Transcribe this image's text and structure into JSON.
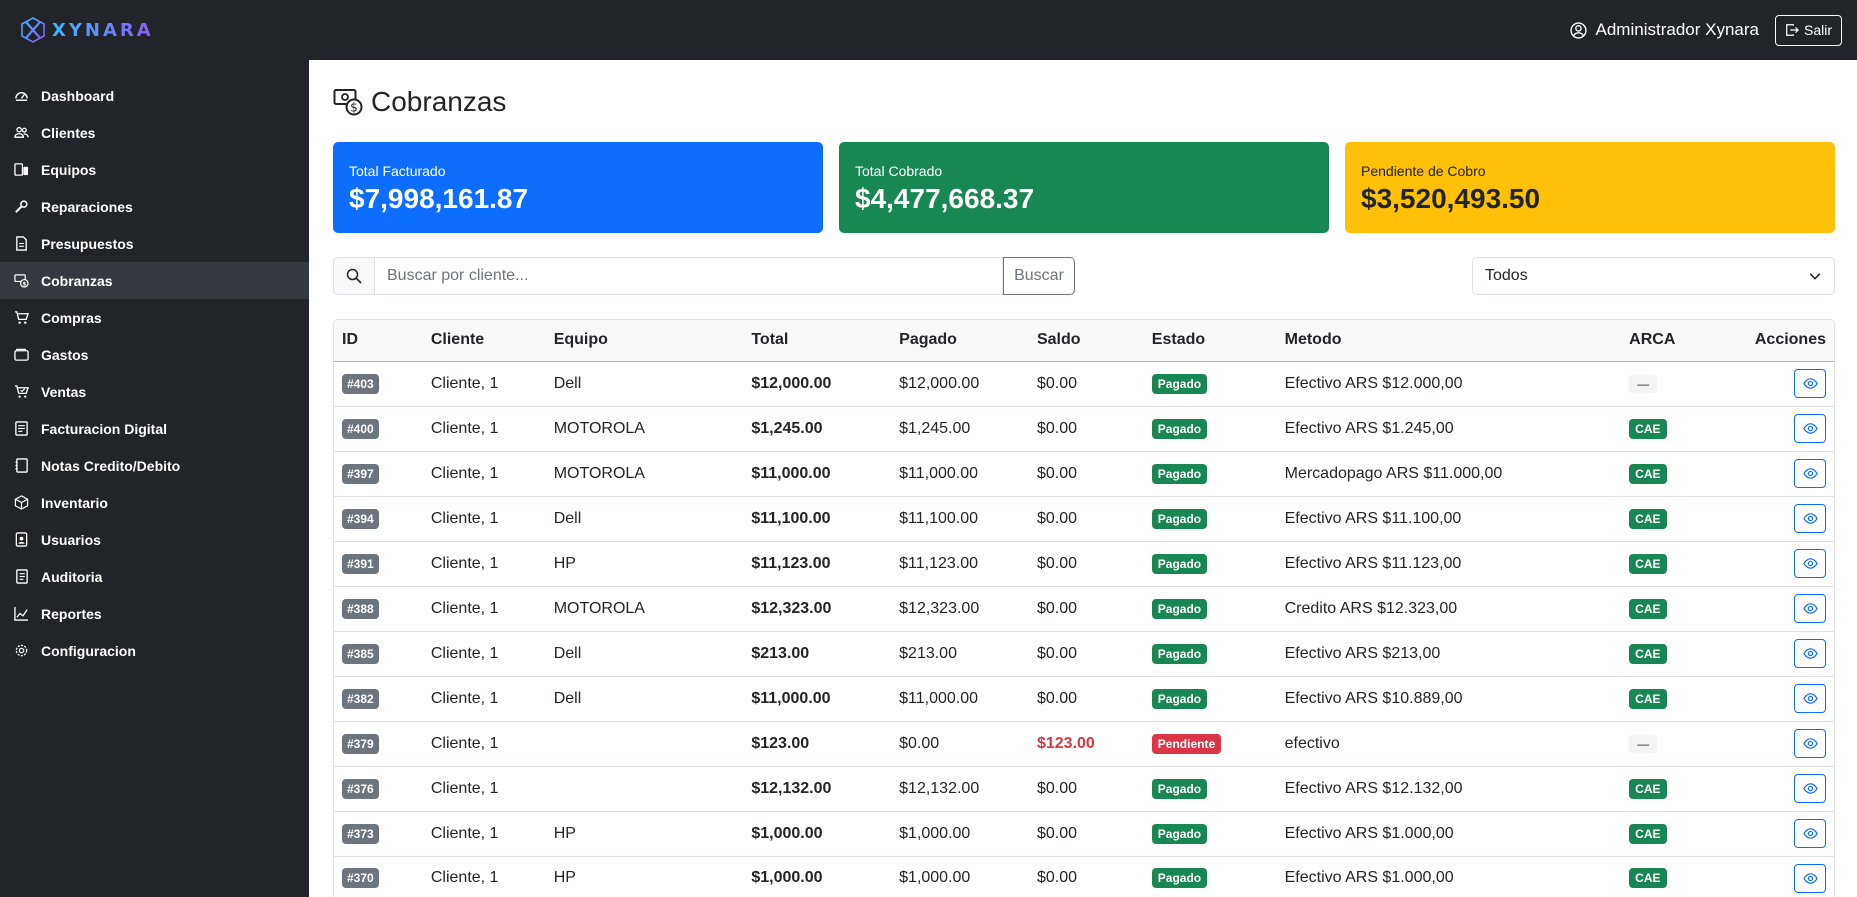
{
  "app": {
    "brand": "XYNARA",
    "user_name": "Administrador Xynara",
    "logout_label": "Salir"
  },
  "sidebar": {
    "items": [
      {
        "label": "Dashboard",
        "icon": "gauge-icon"
      },
      {
        "label": "Clientes",
        "icon": "people-icon"
      },
      {
        "label": "Equipos",
        "icon": "devices-icon"
      },
      {
        "label": "Reparaciones",
        "icon": "wrench-icon"
      },
      {
        "label": "Presupuestos",
        "icon": "document-icon"
      },
      {
        "label": "Cobranzas",
        "icon": "cash-coin-icon",
        "active": true
      },
      {
        "label": "Compras",
        "icon": "cart-icon"
      },
      {
        "label": "Gastos",
        "icon": "wallet-icon"
      },
      {
        "label": "Ventas",
        "icon": "cart-check-icon"
      },
      {
        "label": "Facturacion Digital",
        "icon": "receipt-icon"
      },
      {
        "label": "Notas Credito/Debito",
        "icon": "journal-icon"
      },
      {
        "label": "Inventario",
        "icon": "box-icon"
      },
      {
        "label": "Usuarios",
        "icon": "person-badge-icon"
      },
      {
        "label": "Auditoria",
        "icon": "journal-text-icon"
      },
      {
        "label": "Reportes",
        "icon": "graph-icon"
      },
      {
        "label": "Configuracion",
        "icon": "gear-icon"
      }
    ]
  },
  "page": {
    "title": "Cobranzas"
  },
  "summary": {
    "total_facturado_label": "Total Facturado",
    "total_facturado_value": "$7,998,161.87",
    "total_cobrado_label": "Total Cobrado",
    "total_cobrado_value": "$4,477,668.37",
    "pendiente_label": "Pendiente de Cobro",
    "pendiente_value": "$3,520,493.50"
  },
  "search": {
    "placeholder": "Buscar por cliente...",
    "button_label": "Buscar"
  },
  "filter": {
    "selected": "Todos"
  },
  "colors": {
    "primary": "#0d6efd",
    "success": "#198754",
    "warning": "#ffc107",
    "danger": "#dc3545",
    "dark": "#212529"
  },
  "table": {
    "headers": [
      "ID",
      "Cliente",
      "Equipo",
      "Total",
      "Pagado",
      "Saldo",
      "Estado",
      "Metodo",
      "ARCA",
      "Acciones"
    ],
    "rows": [
      {
        "id": "#403",
        "cliente": "Cliente, 1",
        "equipo": "Dell",
        "total": "$12,000.00",
        "pagado": "$12,000.00",
        "saldo": "$0.00",
        "estado": "Pagado",
        "metodo": "Efectivo ARS $12.000,00",
        "arca": "—"
      },
      {
        "id": "#400",
        "cliente": "Cliente, 1",
        "equipo": "MOTOROLA",
        "total": "$1,245.00",
        "pagado": "$1,245.00",
        "saldo": "$0.00",
        "estado": "Pagado",
        "metodo": "Efectivo ARS $1.245,00",
        "arca": "CAE"
      },
      {
        "id": "#397",
        "cliente": "Cliente, 1",
        "equipo": "MOTOROLA",
        "total": "$11,000.00",
        "pagado": "$11,000.00",
        "saldo": "$0.00",
        "estado": "Pagado",
        "metodo": "Mercadopago ARS $11.000,00",
        "arca": "CAE"
      },
      {
        "id": "#394",
        "cliente": "Cliente, 1",
        "equipo": "Dell",
        "total": "$11,100.00",
        "pagado": "$11,100.00",
        "saldo": "$0.00",
        "estado": "Pagado",
        "metodo": "Efectivo ARS $11.100,00",
        "arca": "CAE"
      },
      {
        "id": "#391",
        "cliente": "Cliente, 1",
        "equipo": "HP",
        "total": "$11,123.00",
        "pagado": "$11,123.00",
        "saldo": "$0.00",
        "estado": "Pagado",
        "metodo": "Efectivo ARS $11.123,00",
        "arca": "CAE"
      },
      {
        "id": "#388",
        "cliente": "Cliente, 1",
        "equipo": "MOTOROLA",
        "total": "$12,323.00",
        "pagado": "$12,323.00",
        "saldo": "$0.00",
        "estado": "Pagado",
        "metodo": "Credito ARS $12.323,00",
        "arca": "CAE"
      },
      {
        "id": "#385",
        "cliente": "Cliente, 1",
        "equipo": "Dell",
        "total": "$213.00",
        "pagado": "$213.00",
        "saldo": "$0.00",
        "estado": "Pagado",
        "metodo": "Efectivo ARS $213,00",
        "arca": "CAE"
      },
      {
        "id": "#382",
        "cliente": "Cliente, 1",
        "equipo": "Dell",
        "total": "$11,000.00",
        "pagado": "$11,000.00",
        "saldo": "$0.00",
        "estado": "Pagado",
        "metodo": "Efectivo ARS $10.889,00",
        "arca": "CAE"
      },
      {
        "id": "#379",
        "cliente": "Cliente, 1",
        "equipo": "",
        "total": "$123.00",
        "pagado": "$0.00",
        "saldo": "$123.00",
        "estado": "Pendiente",
        "metodo": "efectivo",
        "arca": "—"
      },
      {
        "id": "#376",
        "cliente": "Cliente, 1",
        "equipo": "",
        "total": "$12,132.00",
        "pagado": "$12,132.00",
        "saldo": "$0.00",
        "estado": "Pagado",
        "metodo": "Efectivo ARS $12.132,00",
        "arca": "CAE"
      },
      {
        "id": "#373",
        "cliente": "Cliente, 1",
        "equipo": "HP",
        "total": "$1,000.00",
        "pagado": "$1,000.00",
        "saldo": "$0.00",
        "estado": "Pagado",
        "metodo": "Efectivo ARS $1.000,00",
        "arca": "CAE"
      },
      {
        "id": "#370",
        "cliente": "Cliente, 1",
        "equipo": "HP",
        "total": "$1,000.00",
        "pagado": "$1,000.00",
        "saldo": "$0.00",
        "estado": "Pagado",
        "metodo": "Efectivo ARS $1.000,00",
        "arca": "CAE"
      }
    ]
  }
}
